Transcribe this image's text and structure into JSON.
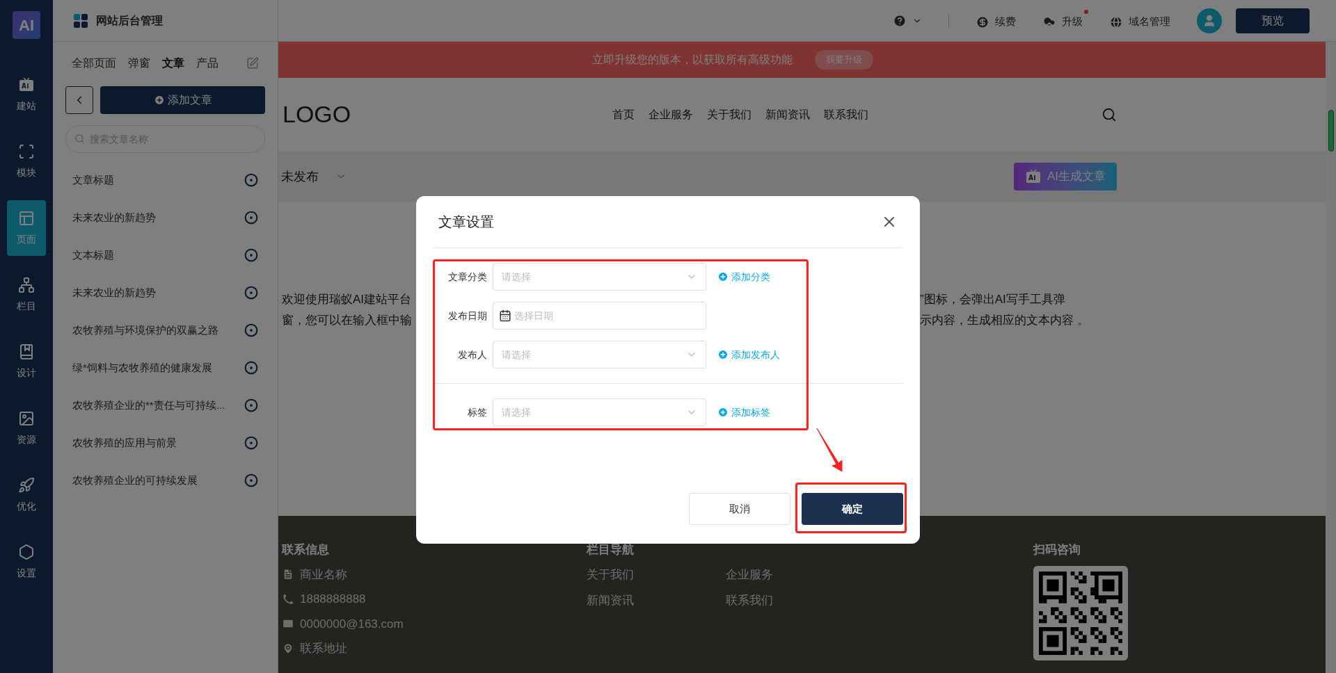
{
  "rail": {
    "logo": "AI",
    "items": [
      {
        "label": "建站",
        "selected": false
      },
      {
        "label": "模块",
        "selected": false
      },
      {
        "label": "页面",
        "selected": true
      },
      {
        "label": "栏目",
        "selected": false
      },
      {
        "label": "设计",
        "selected": false
      },
      {
        "label": "资源",
        "selected": false
      },
      {
        "label": "优化",
        "selected": false
      },
      {
        "label": "设置",
        "selected": false
      }
    ]
  },
  "panel": {
    "title": "网站后台管理",
    "tabs": [
      {
        "label": "全部页面",
        "selected": false
      },
      {
        "label": "弹窗",
        "selected": false
      },
      {
        "label": "文章",
        "selected": true
      },
      {
        "label": "产品",
        "selected": false
      }
    ],
    "add_button": "添加文章",
    "search": {
      "placeholder": "搜索文章名称"
    },
    "articles": [
      "文章标题",
      "未来农业的新趋势",
      "文本标题",
      "未来农业的新趋势",
      "农牧养殖与环境保护的双赢之路",
      "绿*饲料与农牧养殖的健康发展",
      "农牧养殖企业的**责任与可持续...",
      "农牧养殖的应用与前景",
      "农牧养殖企业的可持续发展"
    ]
  },
  "topbar": {
    "items": [
      {
        "label": "续费",
        "badge": false
      },
      {
        "label": "升级",
        "badge": true
      },
      {
        "label": "域名管理",
        "badge": false
      }
    ],
    "preview_button": "预览"
  },
  "banner": {
    "text": "立即升级您的版本，以获取所有高级功能",
    "button": "我要升级"
  },
  "site_header": {
    "logo": "LOGO",
    "nav": [
      "首页",
      "企业服务",
      "关于我们",
      "新闻资讯",
      "联系我们"
    ]
  },
  "toolbar": {
    "status": "未发布",
    "ai_button": "AI生成文章"
  },
  "body_text": [
    {
      "left": "欢迎使用瑞蚁AI建站平台",
      "right": "”图标，会弹出AI写手工具弹"
    },
    {
      "left": "窗，您可以在输入框中输",
      "right": "示内容，生成相应的文本内容 。"
    }
  ],
  "footer": {
    "contact": {
      "heading": "联系信息",
      "items": [
        "商业名称",
        "1888888888",
        "0000000@163.com",
        "联系地址"
      ]
    },
    "nav": {
      "heading": "栏目导航",
      "links": [
        "关于我们",
        "企业服务",
        "新闻资讯",
        "联系我们"
      ]
    },
    "qr": {
      "heading": "扫码咨询"
    }
  },
  "dialog": {
    "title": "文章设置",
    "groups": [
      {
        "fields": [
          {
            "label": "文章分类",
            "kind": "select",
            "placeholder": "请选择",
            "add_link": "添加分类"
          },
          {
            "label": "发布日期",
            "kind": "date",
            "placeholder": "选择日期"
          },
          {
            "label": "发布人",
            "kind": "select",
            "placeholder": "请选择",
            "add_link": "添加发布人"
          }
        ]
      },
      {
        "fields": [
          {
            "label": "标签",
            "kind": "select",
            "placeholder": "请选择",
            "add_link": "添加标签"
          }
        ]
      }
    ],
    "cancel": "取消",
    "confirm": "确定"
  }
}
